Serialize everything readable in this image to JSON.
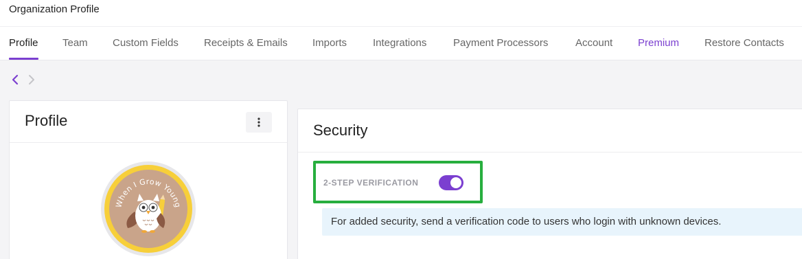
{
  "header": {
    "page_title": "Organization Profile"
  },
  "tabs": [
    {
      "label": "Profile",
      "active": true
    },
    {
      "label": "Team"
    },
    {
      "label": "Custom Fields"
    },
    {
      "label": "Receipts & Emails"
    },
    {
      "label": "Imports"
    },
    {
      "label": "Integrations"
    },
    {
      "label": "Payment Processors"
    },
    {
      "label": "Account"
    },
    {
      "label": "Premium"
    },
    {
      "label": "Restore Contacts"
    }
  ],
  "nav": {
    "back_icon": "chevron-left-icon",
    "forward_icon": "chevron-right-icon"
  },
  "profile_card": {
    "title": "Profile",
    "menu_icon": "more-vertical-icon",
    "logo_text": "When I Grow Young"
  },
  "security": {
    "title": "Security",
    "two_step_label": "2-STEP VERIFICATION",
    "two_step_enabled": true,
    "info_text": "For added security, send a verification code to users who login with unknown devices."
  },
  "colors": {
    "accent": "#7b3fd0",
    "highlight": "#27ae3e",
    "info_background": "#e8f4fc"
  }
}
